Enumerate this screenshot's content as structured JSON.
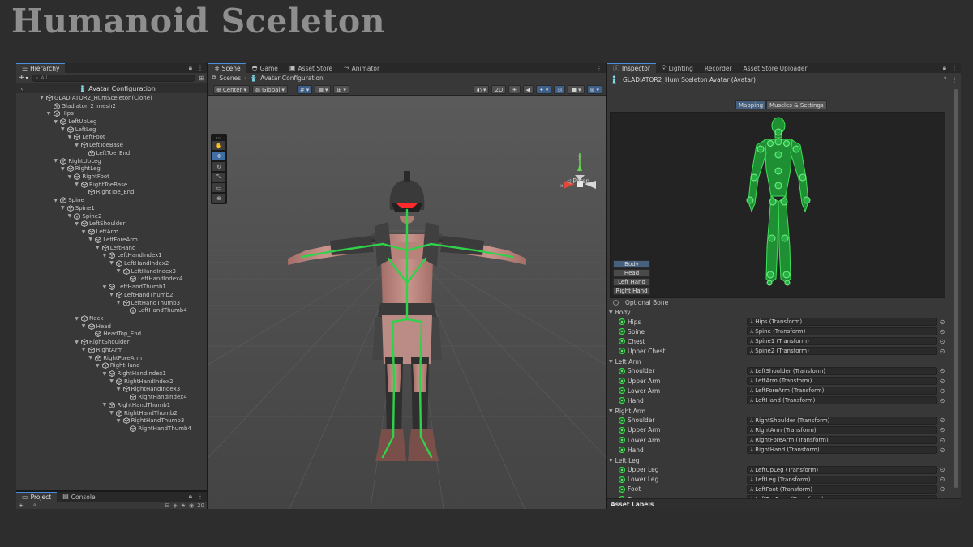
{
  "slide_title": "Humanoid Sceleton",
  "colors": {
    "accent": "#4a8de0",
    "bone_green": "#2fd24a",
    "selected": "#46607f"
  },
  "hierarchy": {
    "tab": "Hierarchy",
    "add_label": "+",
    "add_caret": "▾",
    "search_placeholder": "All",
    "header_title": "Avatar Configuration",
    "rows": [
      {
        "name": "GLADIATOR2_HumSceleton(Clone)",
        "depth": 0,
        "expanded": true
      },
      {
        "name": "Gladiator_2_mesh2",
        "depth": 1,
        "expanded": false
      },
      {
        "name": "Hips",
        "depth": 1,
        "expanded": true
      },
      {
        "name": "LeftUpLeg",
        "depth": 2,
        "expanded": true
      },
      {
        "name": "LeftLeg",
        "depth": 3,
        "expanded": true
      },
      {
        "name": "LeftFoot",
        "depth": 4,
        "expanded": true
      },
      {
        "name": "LeftToeBase",
        "depth": 5,
        "expanded": true
      },
      {
        "name": "LeftToe_End",
        "depth": 6,
        "expanded": false
      },
      {
        "name": "RightUpLeg",
        "depth": 2,
        "expanded": true
      },
      {
        "name": "RightLeg",
        "depth": 3,
        "expanded": true
      },
      {
        "name": "RightFoot",
        "depth": 4,
        "expanded": true
      },
      {
        "name": "RightToeBase",
        "depth": 5,
        "expanded": true
      },
      {
        "name": "RightToe_End",
        "depth": 6,
        "expanded": false
      },
      {
        "name": "Spine",
        "depth": 2,
        "expanded": true
      },
      {
        "name": "Spine1",
        "depth": 3,
        "expanded": true
      },
      {
        "name": "Spine2",
        "depth": 4,
        "expanded": true
      },
      {
        "name": "LeftShoulder",
        "depth": 5,
        "expanded": true
      },
      {
        "name": "LeftArm",
        "depth": 6,
        "expanded": true
      },
      {
        "name": "LeftForeArm",
        "depth": 7,
        "expanded": true
      },
      {
        "name": "LeftHand",
        "depth": 8,
        "expanded": true
      },
      {
        "name": "LeftHandIndex1",
        "depth": 9,
        "expanded": true
      },
      {
        "name": "LeftHandIndex2",
        "depth": 10,
        "expanded": true
      },
      {
        "name": "LeftHandIndex3",
        "depth": 11,
        "expanded": true
      },
      {
        "name": "LeftHandIndex4",
        "depth": 12,
        "expanded": false
      },
      {
        "name": "LeftHandThumb1",
        "depth": 9,
        "expanded": true
      },
      {
        "name": "LeftHandThumb2",
        "depth": 10,
        "expanded": true
      },
      {
        "name": "LeftHandThumb3",
        "depth": 11,
        "expanded": true
      },
      {
        "name": "LeftHandThumb4",
        "depth": 12,
        "expanded": false
      },
      {
        "name": "Neck",
        "depth": 5,
        "expanded": true
      },
      {
        "name": "Head",
        "depth": 6,
        "expanded": true
      },
      {
        "name": "HeadTop_End",
        "depth": 7,
        "expanded": false
      },
      {
        "name": "RightShoulder",
        "depth": 5,
        "expanded": true
      },
      {
        "name": "RightArm",
        "depth": 6,
        "expanded": true
      },
      {
        "name": "RightForeArm",
        "depth": 7,
        "expanded": true
      },
      {
        "name": "RightHand",
        "depth": 8,
        "expanded": true
      },
      {
        "name": "RightHandIndex1",
        "depth": 9,
        "expanded": true
      },
      {
        "name": "RightHandIndex2",
        "depth": 10,
        "expanded": true
      },
      {
        "name": "RightHandIndex3",
        "depth": 11,
        "expanded": true
      },
      {
        "name": "RightHandIndex4",
        "depth": 12,
        "expanded": false
      },
      {
        "name": "RightHandThumb1",
        "depth": 9,
        "expanded": true
      },
      {
        "name": "RightHandThumb2",
        "depth": 10,
        "expanded": true
      },
      {
        "name": "RightHandThumb3",
        "depth": 11,
        "expanded": true
      },
      {
        "name": "RightHandThumb4",
        "depth": 12,
        "expanded": false
      }
    ]
  },
  "bottom_tabs": {
    "project": "Project",
    "console": "Console",
    "add_label": "+",
    "count_label": "20"
  },
  "scene": {
    "tabs": [
      {
        "label": "Scene",
        "icon": "grid-icon",
        "active": true
      },
      {
        "label": "Game",
        "icon": "gamepad-icon",
        "active": false
      },
      {
        "label": "Asset Store",
        "icon": "bag-icon",
        "active": false
      },
      {
        "label": "Animator",
        "icon": "animator-icon",
        "active": false
      }
    ],
    "breadcrumb_scenes": "Scenes",
    "breadcrumb_avatar": "Avatar Configuration",
    "pivot_label": "Center",
    "space_label": "Global",
    "mode_2d": "2D",
    "persp_label": "Persp"
  },
  "inspector": {
    "tabs": [
      {
        "label": "Inspector",
        "icon": "info-icon",
        "active": true
      },
      {
        "label": "Lighting",
        "icon": "bulb-icon",
        "active": false
      },
      {
        "label": "Recorder",
        "icon": "",
        "active": false
      },
      {
        "label": "Asset Store Uploader",
        "icon": "",
        "active": false
      }
    ],
    "title": "GLADIATOR2_Hum Sceleton Avatar (Avatar)",
    "mapping_tab": "Mapping",
    "muscles_tab": "Muscles & Settings",
    "parts": [
      "Body",
      "Head",
      "Left Hand",
      "Right Hand"
    ],
    "optional_label": "Optional Bone",
    "groups": [
      {
        "name": "Body",
        "bones": [
          {
            "name": "Hips",
            "transform": "Hips (Transform)"
          },
          {
            "name": "Spine",
            "transform": "Spine (Transform)"
          },
          {
            "name": "Chest",
            "transform": "Spine1 (Transform)"
          },
          {
            "name": "Upper Chest",
            "transform": "Spine2 (Transform)"
          }
        ]
      },
      {
        "name": "Left Arm",
        "bones": [
          {
            "name": "Shoulder",
            "transform": "LeftShoulder (Transform)"
          },
          {
            "name": "Upper Arm",
            "transform": "LeftArm (Transform)"
          },
          {
            "name": "Lower Arm",
            "transform": "LeftForeArm (Transform)"
          },
          {
            "name": "Hand",
            "transform": "LeftHand (Transform)"
          }
        ]
      },
      {
        "name": "Right Arm",
        "bones": [
          {
            "name": "Shoulder",
            "transform": "RightShoulder (Transform)"
          },
          {
            "name": "Upper Arm",
            "transform": "RightArm (Transform)"
          },
          {
            "name": "Lower Arm",
            "transform": "RightForeArm (Transform)"
          },
          {
            "name": "Hand",
            "transform": "RightHand (Transform)"
          }
        ]
      },
      {
        "name": "Left Leg",
        "bones": [
          {
            "name": "Upper Leg",
            "transform": "LeftUpLeg (Transform)"
          },
          {
            "name": "Lower Leg",
            "transform": "LeftLeg (Transform)"
          },
          {
            "name": "Foot",
            "transform": "LeftFoot (Transform)"
          },
          {
            "name": "Toes",
            "transform": "LeftToeBase (Transform)"
          }
        ]
      }
    ],
    "asset_labels": "Asset Labels"
  }
}
